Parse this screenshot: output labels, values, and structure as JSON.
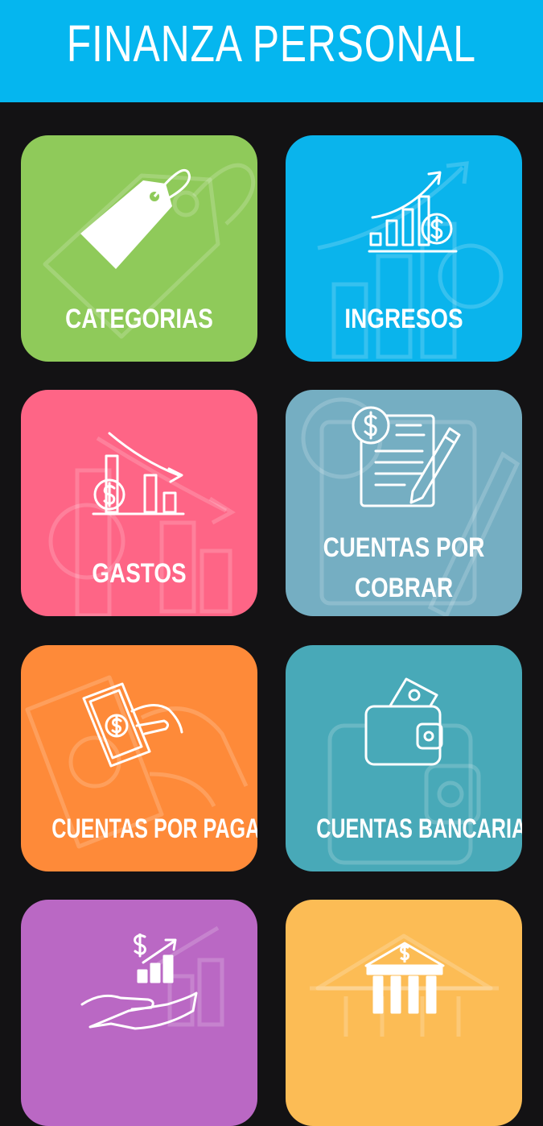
{
  "header": {
    "title": "FINANZA PERSONAL"
  },
  "tiles": [
    {
      "label": "CATEGORIAS",
      "icon": "price-tag-icon",
      "color": "#8fca5a"
    },
    {
      "label": "INGRESOS",
      "icon": "income-growth-icon",
      "color": "#0ab4ec"
    },
    {
      "label": "GASTOS",
      "icon": "expense-decline-icon",
      "color": "#fe6586"
    },
    {
      "label": "CUENTAS POR COBRAR",
      "label_line1": "CUENTAS POR",
      "label_line2": "COBRAR",
      "icon": "invoice-pen-icon",
      "color": "#75aec2"
    },
    {
      "label": "CUENTAS POR PAGAR",
      "icon": "hand-cash-icon",
      "color": "#fe8a39"
    },
    {
      "label": "CUENTAS BANCARIAS",
      "icon": "wallet-icon",
      "color": "#48a9b8"
    },
    {
      "label": "",
      "icon": "investment-hand-icon",
      "color": "#ba68c4"
    },
    {
      "label": "",
      "icon": "bank-building-icon",
      "color": "#fcbc55"
    }
  ]
}
